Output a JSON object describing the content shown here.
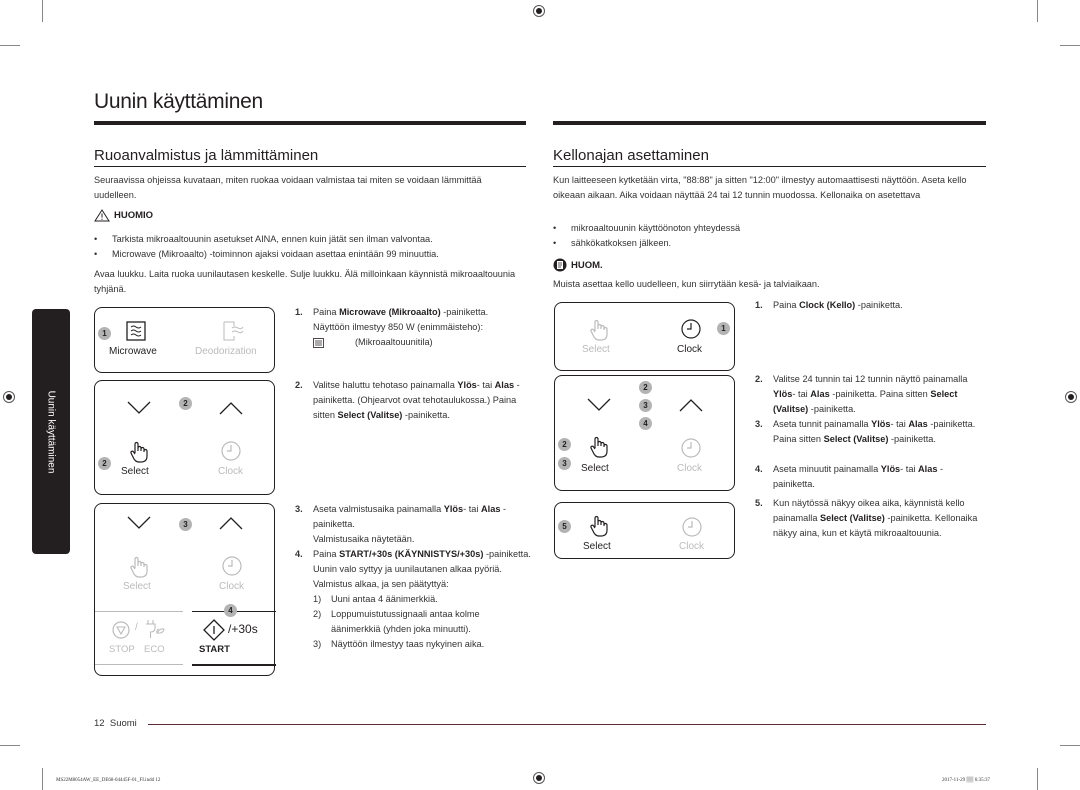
{
  "page": {
    "title": "Uunin käyttäminen",
    "side_tab": "Uunin käyttäminen",
    "footer": {
      "page_number": "12",
      "language": "Suomi"
    },
    "slug": {
      "file": "MS22M8054AW_EE_DE68-04445F-01_FI.indd   12",
      "timestamp": "2017-11-29   ▒▒ 6:35:37"
    }
  },
  "left_section": {
    "title": "Ruoanvalmistus ja lämmittäminen",
    "intro": "Seuraavissa ohjeissa kuvataan, miten ruokaa voidaan valmistaa tai miten se voidaan lämmittää uudelleen.",
    "caution": {
      "icon": "warning-triangle-icon",
      "label": "HUOMIO",
      "items": [
        "Tarkista mikroaaltouunin asetukset AINA, ennen kuin jätät sen ilman valvontaa.",
        "Microwave (Mikroaalto) -toiminnon ajaksi voidaan asettaa enintään 99 minuuttia."
      ]
    },
    "instruction": "Avaa luukku. Laita ruoka uunilautasen keskelle. Sulje luukku. Älä milloinkaan käynnistä mikroaaltouunia tyhjänä.",
    "panels": {
      "p1": {
        "badge": "1",
        "microwave": "Microwave",
        "deodorization": "Deodorization"
      },
      "p2": {
        "badge_arrows": "2",
        "badge_select": "2",
        "select": "Select",
        "clock": "Clock"
      },
      "p3": {
        "badge_arrows": "3",
        "badge_start": "4",
        "select": "Select",
        "clock": "Clock",
        "stop": "STOP",
        "eco": "ECO",
        "start": "START",
        "plus30": "/+30s",
        "slash": "/"
      }
    },
    "steps": [
      {
        "n": "1.",
        "pre": "Paina ",
        "bold": "Microwave (Mikroaalto)",
        "post": " -painiketta.",
        "line2": "Näyttöön ilmestyy 850 W (enimmäisteho):",
        "line3": "(Mikroaaltouunitila)"
      },
      {
        "n": "2.",
        "text1": "Valitse haluttu tehotaso painamalla",
        "b1": "Ylös",
        "t2": "- tai ",
        "b2": "Alas",
        "t3": " -painiketta. (Ohjearvot ovat tehotaulukossa.) Paina sitten ",
        "b3": "Select (Valitse)",
        "t4": " -painiketta."
      },
      {
        "n": "3.",
        "t1": "Aseta valmistusaika painamalla ",
        "b1": "Ylös",
        "t2": "- tai ",
        "b2": "Alas",
        "t3": " -painiketta.",
        "line2": "Valmistusaika näytetään."
      },
      {
        "n": "4.",
        "t1": "Paina ",
        "b1": "START/+30s (KÄYNNISTYS/+30s)",
        "t2": " -painiketta.",
        "line2": "Uunin valo syttyy ja uunilautanen alkaa pyöriä.",
        "line3": "Valmistus alkaa, ja sen päätyttyä:",
        "subs": [
          {
            "n": "1)",
            "text": "Uuni antaa 4 äänimerkkiä."
          },
          {
            "n": "2)",
            "text": "Loppumuistutussignaali antaa kolme äänimerkkiä (yhden joka minuutti)."
          },
          {
            "n": "3)",
            "text": "Näyttöön ilmestyy taas nykyinen aika."
          }
        ]
      }
    ]
  },
  "right_section": {
    "title": "Kellonajan asettaminen",
    "intro": "Kun laitteeseen kytketään virta, \"88:88\" ja sitten \"12:00\" ilmestyy automaattisesti näyttöön. Aseta kello oikeaan aikaan. Aika voidaan näyttää 24 tai 12 tunnin muodossa. Kellonaika on asetettava",
    "items": [
      "mikroaaltouunin käyttöönoton yhteydessä",
      "sähkökatkoksen jälkeen."
    ],
    "note": {
      "icon": "note-icon",
      "label": "HUOM.",
      "text": "Muista asettaa kello uudelleen, kun siirrytään kesä- ja talviaikaan."
    },
    "panels": {
      "p1": {
        "badge": "1",
        "select": "Select",
        "clock": "Clock"
      },
      "p2": {
        "badges_arrows": [
          "2",
          "3",
          "4"
        ],
        "badges_select": [
          "2",
          "3"
        ],
        "select": "Select",
        "clock": "Clock"
      },
      "p3": {
        "badge": "5",
        "select": "Select",
        "clock": "Clock"
      }
    },
    "steps": [
      {
        "n": "1.",
        "t1": "Paina ",
        "b1": "Clock (Kello)",
        "t2": " -painiketta."
      },
      {
        "n": "2.",
        "t1": "Valitse 24 tunnin tai 12 tunnin näyttö painamalla ",
        "b1": "Ylös",
        "t2": "- tai ",
        "b2": "Alas",
        "t3": " -painiketta. Paina sitten ",
        "b3": "Select (Valitse)",
        "t4": " -painiketta."
      },
      {
        "n": "3.",
        "t1": "Aseta tunnit painamalla ",
        "b1": "Ylös",
        "t2": "- tai ",
        "b2": "Alas",
        "t3": " -painiketta. Paina sitten ",
        "b3": "Select (Valitse)",
        "t4": " -painiketta."
      },
      {
        "n": "4.",
        "t1": "Aseta minuutit painamalla ",
        "b1": "Ylös",
        "t2": "- tai ",
        "b2": "Alas",
        "t3": " -painiketta."
      },
      {
        "n": "5.",
        "t1": "Kun näytössä näkyy oikea aika, käynnistä kello painamalla ",
        "b1": "Select (Valitse)",
        "t2": " -painiketta. Kellonaika näkyy aina, kun et käytä mikroaaltouunia."
      }
    ]
  }
}
